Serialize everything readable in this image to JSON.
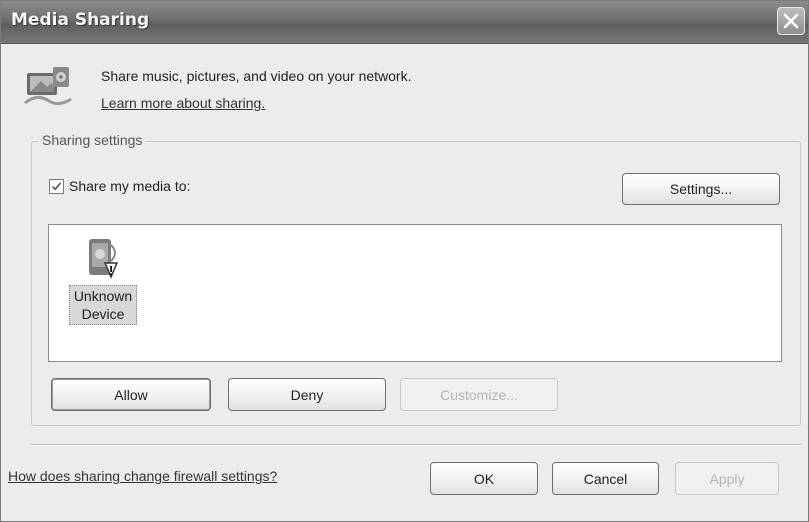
{
  "window": {
    "title": "Media Sharing"
  },
  "header": {
    "description": "Share music, pictures, and video on your network.",
    "learn_link": "Learn more about sharing."
  },
  "sharing": {
    "group_label": "Sharing settings",
    "share_checkbox_label": "Share my media to:",
    "share_checked": true,
    "settings_button": "Settings...",
    "devices": [
      {
        "name": "Unknown Device",
        "icon": "unknown-device-icon"
      }
    ],
    "allow_button": "Allow",
    "deny_button": "Deny",
    "customize_button": "Customize..."
  },
  "footer": {
    "firewall_link": "How does sharing change firewall settings?",
    "ok_button": "OK",
    "cancel_button": "Cancel",
    "apply_button": "Apply"
  },
  "icons": {
    "header": "media-sharing-icon",
    "close": "close-icon",
    "check": "checkmark-icon"
  }
}
